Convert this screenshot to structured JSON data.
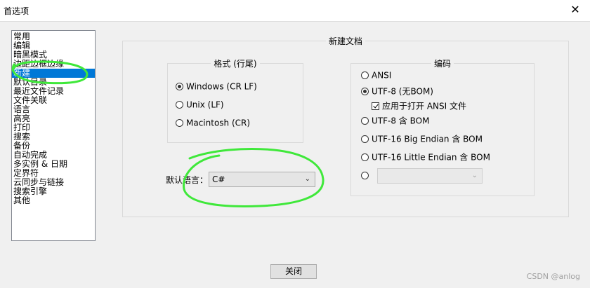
{
  "window": {
    "title": "首选项"
  },
  "sidebar": {
    "items": [
      {
        "label": "常用"
      },
      {
        "label": "编辑"
      },
      {
        "label": "暗黑模式"
      },
      {
        "label": "边距边框边缘"
      },
      {
        "label": "新建",
        "selected": true
      },
      {
        "label": "默认目录"
      },
      {
        "label": "最近文件记录"
      },
      {
        "label": "文件关联"
      },
      {
        "label": "语言"
      },
      {
        "label": "高亮"
      },
      {
        "label": "打印"
      },
      {
        "label": "搜索"
      },
      {
        "label": "备份"
      },
      {
        "label": "自动完成"
      },
      {
        "label": "多实例 & 日期"
      },
      {
        "label": "定界符"
      },
      {
        "label": "云同步与链接"
      },
      {
        "label": "搜索引擎"
      },
      {
        "label": "其他"
      }
    ]
  },
  "new_doc": {
    "title": "新建文档",
    "format": {
      "title": "格式 (行尾)",
      "options": [
        {
          "label": "Windows (CR LF)",
          "checked": true
        },
        {
          "label": "Unix (LF)",
          "checked": false
        },
        {
          "label": "Macintosh (CR)",
          "checked": false
        }
      ]
    },
    "encoding": {
      "title": "编码",
      "ansi": "ANSI",
      "utf8_nobom": "UTF-8 (无BOM)",
      "apply_ansi": "应用于打开 ANSI 文件",
      "utf8_bom": "UTF-8 含 BOM",
      "utf16_be": "UTF-16 Big Endian 含 BOM",
      "utf16_le": "UTF-16 Little Endian 含 BOM",
      "selected": "UTF-8 (无BOM)"
    },
    "default_language": {
      "label": "默认语言：",
      "value": "C#"
    }
  },
  "footer": {
    "close_label": "关闭"
  },
  "watermark": "CSDN @anlog",
  "colors": {
    "selection": "#0078d7",
    "annotation": "#3fe83a"
  }
}
